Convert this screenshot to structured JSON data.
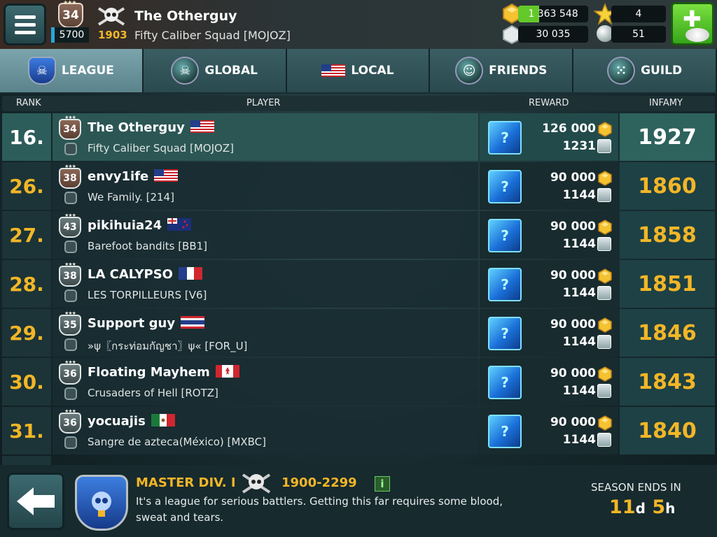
{
  "top": {
    "level": "34",
    "xp": "5700",
    "infamy": "1903",
    "player_name": "The Otherguy",
    "guild": "Fifty Caliber Squad [MOJOZ]",
    "gold": "1 363 548",
    "silver": "30 035",
    "stars": "4",
    "pearls": "51"
  },
  "tabs": [
    {
      "label": "LEAGUE",
      "icon": "league-shield-icon"
    },
    {
      "label": "GLOBAL",
      "icon": "global-skull-icon"
    },
    {
      "label": "LOCAL",
      "icon": "us-flag-icon"
    },
    {
      "label": "FRIENDS",
      "icon": "friends-icon"
    },
    {
      "label": "GUILD",
      "icon": "guild-icon"
    }
  ],
  "columns": {
    "rank": "RANK",
    "player": "PLAYER",
    "reward": "REWARD",
    "infamy": "INFAMY"
  },
  "rows": [
    {
      "rank": "16.",
      "level": "34",
      "name": "The Otherguy",
      "flag": "US",
      "guild": "Fifty Caliber Squad [MOJOZ]",
      "gold": "126 000",
      "silver": "1231",
      "infamy": "1927",
      "me": true
    },
    {
      "rank": "26.",
      "level": "38",
      "name": "envy1ife",
      "flag": "US",
      "guild": "We Family. [214]",
      "gold": "90 000",
      "silver": "1144",
      "infamy": "1860"
    },
    {
      "rank": "27.",
      "level": "43",
      "name": "pikihuia24",
      "flag": "NZ",
      "guild": "Barefoot bandits [BB1]",
      "gold": "90 000",
      "silver": "1144",
      "infamy": "1858"
    },
    {
      "rank": "28.",
      "level": "38",
      "name": "LA CALYPSO",
      "flag": "FR",
      "guild": "LES TORPILLEURS [V6]",
      "gold": "90 000",
      "silver": "1144",
      "infamy": "1851"
    },
    {
      "rank": "29.",
      "level": "35",
      "name": "Support guy",
      "flag": "TH",
      "guild": "»ψ〖กระท่อมกัญชา〗ψ« [FOR_U]",
      "gold": "90 000",
      "silver": "1144",
      "infamy": "1846"
    },
    {
      "rank": "30.",
      "level": "36",
      "name": "Floating Mayhem",
      "flag": "CA",
      "guild": "Crusaders of Hell [ROTZ]",
      "gold": "90 000",
      "silver": "1144",
      "infamy": "1843"
    },
    {
      "rank": "31.",
      "level": "36",
      "name": "yocuajis",
      "flag": "MX",
      "guild": "Sangre de azteca(México) [MXBC]",
      "gold": "90 000",
      "silver": "1144",
      "infamy": "1840"
    }
  ],
  "footer": {
    "league_title": "MASTER DIV. I",
    "range": "1900-2299",
    "info_label": "i",
    "description": "It's a league for serious battlers. Getting this far requires some blood, sweat and tears.",
    "season_label": "SEASON ENDS IN",
    "days": "11",
    "days_unit": "d",
    "hours": "5",
    "hours_unit": "h"
  },
  "colors": {
    "accent_gold": "#f2b627",
    "highlight_row": "#2b5654",
    "shop_green": "#4cc22a"
  }
}
